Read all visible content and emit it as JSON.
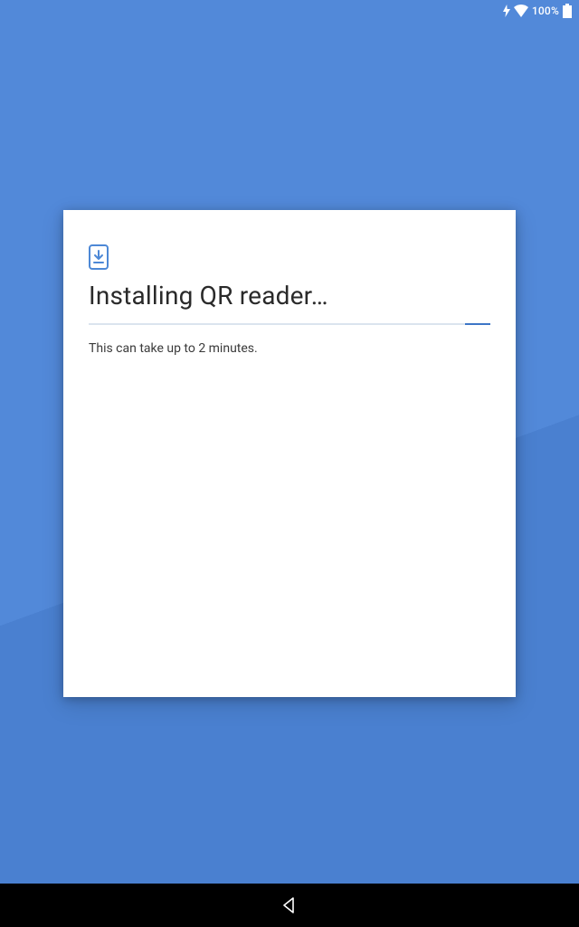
{
  "status": {
    "battery_percent": "100%"
  },
  "card": {
    "title": "Installing QR reader…",
    "subtext": "This can take up to 2 minutes."
  }
}
